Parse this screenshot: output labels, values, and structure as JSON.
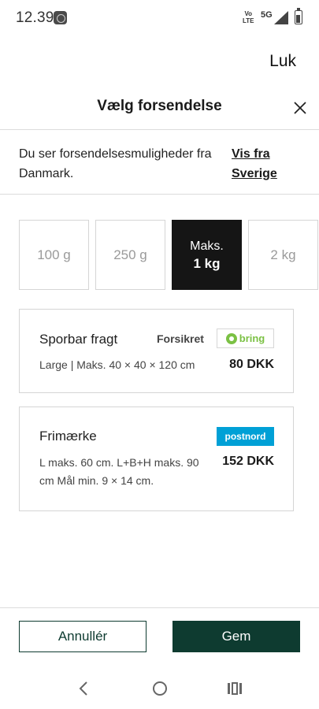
{
  "status_bar": {
    "time": "12.39",
    "volte_top": "Vo",
    "volte_bottom": "LTE",
    "network": "5G"
  },
  "header": {
    "close_label": "Luk",
    "title": "Vælg forsendelse"
  },
  "info": {
    "text": "Du ser forsendelsesmuligheder fra Danmark.",
    "link": "Vis fra Sverige"
  },
  "weights": [
    {
      "label": "100 g",
      "selected": false
    },
    {
      "label": "250 g",
      "selected": false
    },
    {
      "label_top": "Maks.",
      "label_bottom": "1 kg",
      "selected": true
    },
    {
      "label": "2 kg",
      "selected": false
    }
  ],
  "shipping_options": [
    {
      "name": "Sporbar fragt",
      "badge": "Forsikret",
      "carrier_logo": "bring",
      "description": "Large | Maks. 40 × 40 × 120 cm",
      "price": "80 DKK"
    },
    {
      "name": "Frimærke",
      "carrier_logo": "postnord",
      "description": "L maks. 60 cm. L+B+H maks. 90 cm Mål min. 9 × 14 cm.",
      "price": "152 DKK"
    }
  ],
  "footer": {
    "cancel_label": "Annullér",
    "save_label": "Gem"
  },
  "colors": {
    "primary": "#0e3b30",
    "selected_chip": "#151515",
    "bring_green": "#7bc144",
    "postnord_blue": "#00a0d6"
  },
  "icons": [
    "close-icon",
    "back-nav-icon",
    "home-nav-icon",
    "recents-nav-icon",
    "signal-icon",
    "battery-icon"
  ]
}
